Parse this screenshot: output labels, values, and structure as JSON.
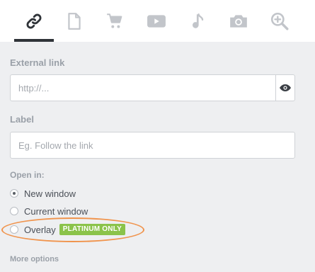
{
  "tabs": [
    {
      "icon": "link-icon",
      "active": true
    },
    {
      "icon": "document-icon",
      "active": false
    },
    {
      "icon": "cart-icon",
      "active": false
    },
    {
      "icon": "video-icon",
      "active": false
    },
    {
      "icon": "music-note-icon",
      "active": false
    },
    {
      "icon": "camera-icon",
      "active": false
    },
    {
      "icon": "zoom-in-icon",
      "active": false
    }
  ],
  "external_link": {
    "label": "External link",
    "placeholder": "http://...",
    "value": "",
    "toggle_icon": "eye-icon"
  },
  "label_field": {
    "label": "Label",
    "placeholder": "Eg. Follow the link",
    "value": ""
  },
  "open_in": {
    "label": "Open in:",
    "options": [
      {
        "label": "New window",
        "selected": true
      },
      {
        "label": "Current window",
        "selected": false
      },
      {
        "label": "Overlay",
        "selected": false,
        "badge": "PLATINUM ONLY"
      }
    ]
  },
  "more_options": {
    "label": "More options"
  },
  "colors": {
    "active_icon": "#2f3338",
    "inactive_icon": "#c2c5ca",
    "badge": "#8bc34a",
    "highlight": "#f0944d"
  }
}
